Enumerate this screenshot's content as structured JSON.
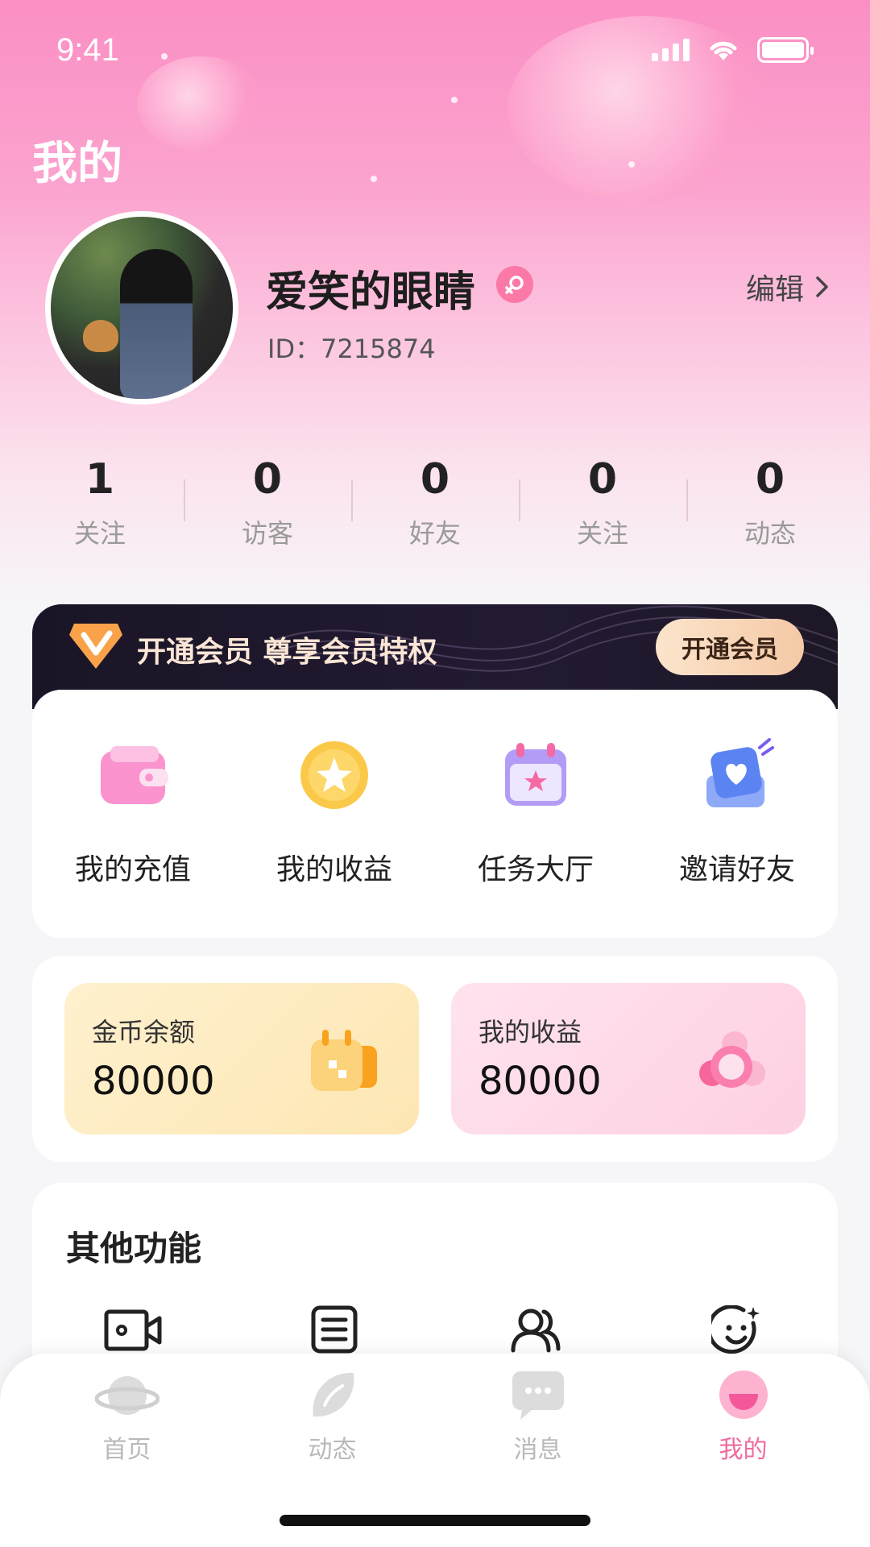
{
  "status_bar": {
    "time": "9:41"
  },
  "header": {
    "title": "我的"
  },
  "profile": {
    "username": "爱笑的眼睛",
    "id_text": "ID：7215874",
    "edit_label": "编辑",
    "gender": "female-icon"
  },
  "stats": [
    {
      "value": "1",
      "label": "关注"
    },
    {
      "value": "0",
      "label": "访客"
    },
    {
      "value": "0",
      "label": "好友"
    },
    {
      "value": "0",
      "label": "关注"
    },
    {
      "value": "0",
      "label": "动态"
    }
  ],
  "vip": {
    "text": "开通会员  尊享会员特权",
    "button_label": "开通会员"
  },
  "quick_actions": [
    {
      "label": "我的充值",
      "icon": "wallet-icon"
    },
    {
      "label": "我的收益",
      "icon": "star-coin-icon"
    },
    {
      "label": "任务大厅",
      "icon": "calendar-star-icon"
    },
    {
      "label": "邀请好友",
      "icon": "heart-invite-icon"
    }
  ],
  "wallet": {
    "coins": {
      "title": "金币余额",
      "value": "80000",
      "icon": "coin-box-icon"
    },
    "income": {
      "title": "我的收益",
      "value": "80000",
      "icon": "income-icon"
    }
  },
  "other": {
    "title": "其他功能",
    "icons": [
      "video-camera-icon",
      "document-icon",
      "users-icon",
      "smile-sparkle-icon"
    ]
  },
  "tab_bar": {
    "items": [
      {
        "label": "首页",
        "icon": "planet-icon"
      },
      {
        "label": "动态",
        "icon": "leaf-icon"
      },
      {
        "label": "消息",
        "icon": "chat-icon"
      },
      {
        "label": "我的",
        "icon": "me-icon",
        "active": true
      }
    ]
  },
  "colors": {
    "accent": "#f06aa0",
    "vip_bg": "#1a1526",
    "coins_bg": "#fde6b3",
    "income_bg": "#fdd0e3"
  }
}
